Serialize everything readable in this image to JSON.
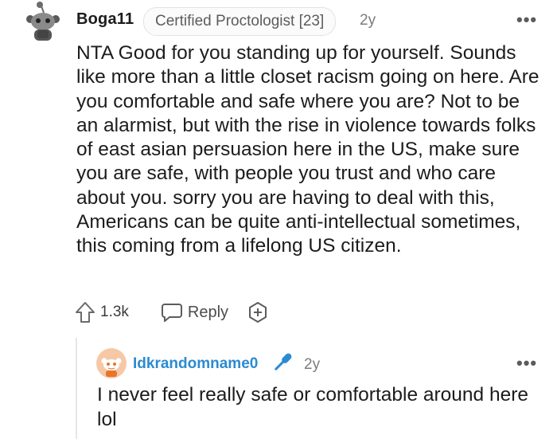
{
  "comment": {
    "username": "Boga11",
    "flair": "Certified Proctologist [23]",
    "age": "2y",
    "more_label": "•••",
    "body": "NTA Good for you standing up for yourself. Sounds like more than a little closet racism going on here. Are you comfortable and safe where you are? Not to be an alarmist, but with the rise in violence towards folks of east asian persuasion here in the US, make sure you are safe, with people you trust and who care about you. sorry you are having to deal with this, Americans can be quite anti-intellectual sometimes, this coming from a lifelong US citizen.",
    "upvotes": "1.3k",
    "reply_label": "Reply",
    "icons": {
      "avatar": "snoo-avatar-icon",
      "upvote": "upvote-arrow-icon",
      "reply": "speech-bubble-icon",
      "award": "add-award-icon"
    }
  },
  "reply": {
    "username": "Idkrandomname0",
    "age": "2y",
    "more_label": "•••",
    "body": "I never feel really safe or comfortable around here lol",
    "icons": {
      "avatar": "orange-snoo-avatar-icon",
      "badge": "microphone-icon"
    },
    "username_color": "#2b8bd1",
    "badge_color": "#2b8bd1"
  }
}
